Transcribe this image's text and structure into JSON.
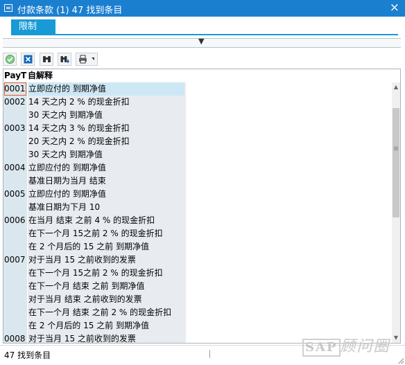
{
  "window": {
    "title": "付款条款 (1)   47 找到条目",
    "close_label": "×"
  },
  "tabs": [
    {
      "label": "限制"
    }
  ],
  "collapse_arrow": "▼",
  "toolbar": {
    "buttons": [
      {
        "name": "confirm-icon",
        "color": "#3fa34d"
      },
      {
        "name": "cancel-icon",
        "color": "#1466b8"
      },
      {
        "name": "find-icon",
        "color": "#333333"
      },
      {
        "name": "find-next-icon",
        "color": "#333333"
      },
      {
        "name": "print-icon",
        "color": "#333333"
      }
    ]
  },
  "grid": {
    "headers": {
      "code": "PayT",
      "text": "自解释"
    },
    "rows": [
      {
        "code": "0001",
        "text": "立即应付的 到期净值",
        "selected": true
      },
      {
        "code": "0002",
        "text": "14 天之内 2 % 的现金折扣"
      },
      {
        "code": "",
        "text": "30 天之内 到期净值"
      },
      {
        "code": "0003",
        "text": "14 天之内 3 % 的现金折扣"
      },
      {
        "code": "",
        "text": "20 天之内 2 % 的现金折扣"
      },
      {
        "code": "",
        "text": "30 天之内 到期净值"
      },
      {
        "code": "0004",
        "text": "立即应付的 到期净值"
      },
      {
        "code": "",
        "text": "基准日期为当月 结束"
      },
      {
        "code": "0005",
        "text": "立即应付的 到期净值"
      },
      {
        "code": "",
        "text": "基准日期为下月 10"
      },
      {
        "code": "0006",
        "text": "在当月 结束 之前 4 % 的现金折扣"
      },
      {
        "code": "",
        "text": "在下一个月 15之前 2 % 的现金折扣"
      },
      {
        "code": "",
        "text": "在 2 个月后的 15 之前 到期净值"
      },
      {
        "code": "0007",
        "text": "对于当月 15 之前收到的发票"
      },
      {
        "code": "",
        "text": "在下一个月 15之前 2 % 的现金折扣"
      },
      {
        "code": "",
        "text": "在下一个月 结束 之前 到期净值"
      },
      {
        "code": "",
        "text": "对于当月 结束  之前收到的发票"
      },
      {
        "code": "",
        "text": "在下一个月 结束 之前 2 % 的现金折扣"
      },
      {
        "code": "",
        "text": "在 2 个月后的 15 之前 到期净值"
      },
      {
        "code": "0008",
        "text": "对于当月 15 之前收到的发票"
      }
    ]
  },
  "status": {
    "message": "47 找到条目"
  },
  "watermark": {
    "brand": "SAP",
    "text": "顾问圈"
  }
}
